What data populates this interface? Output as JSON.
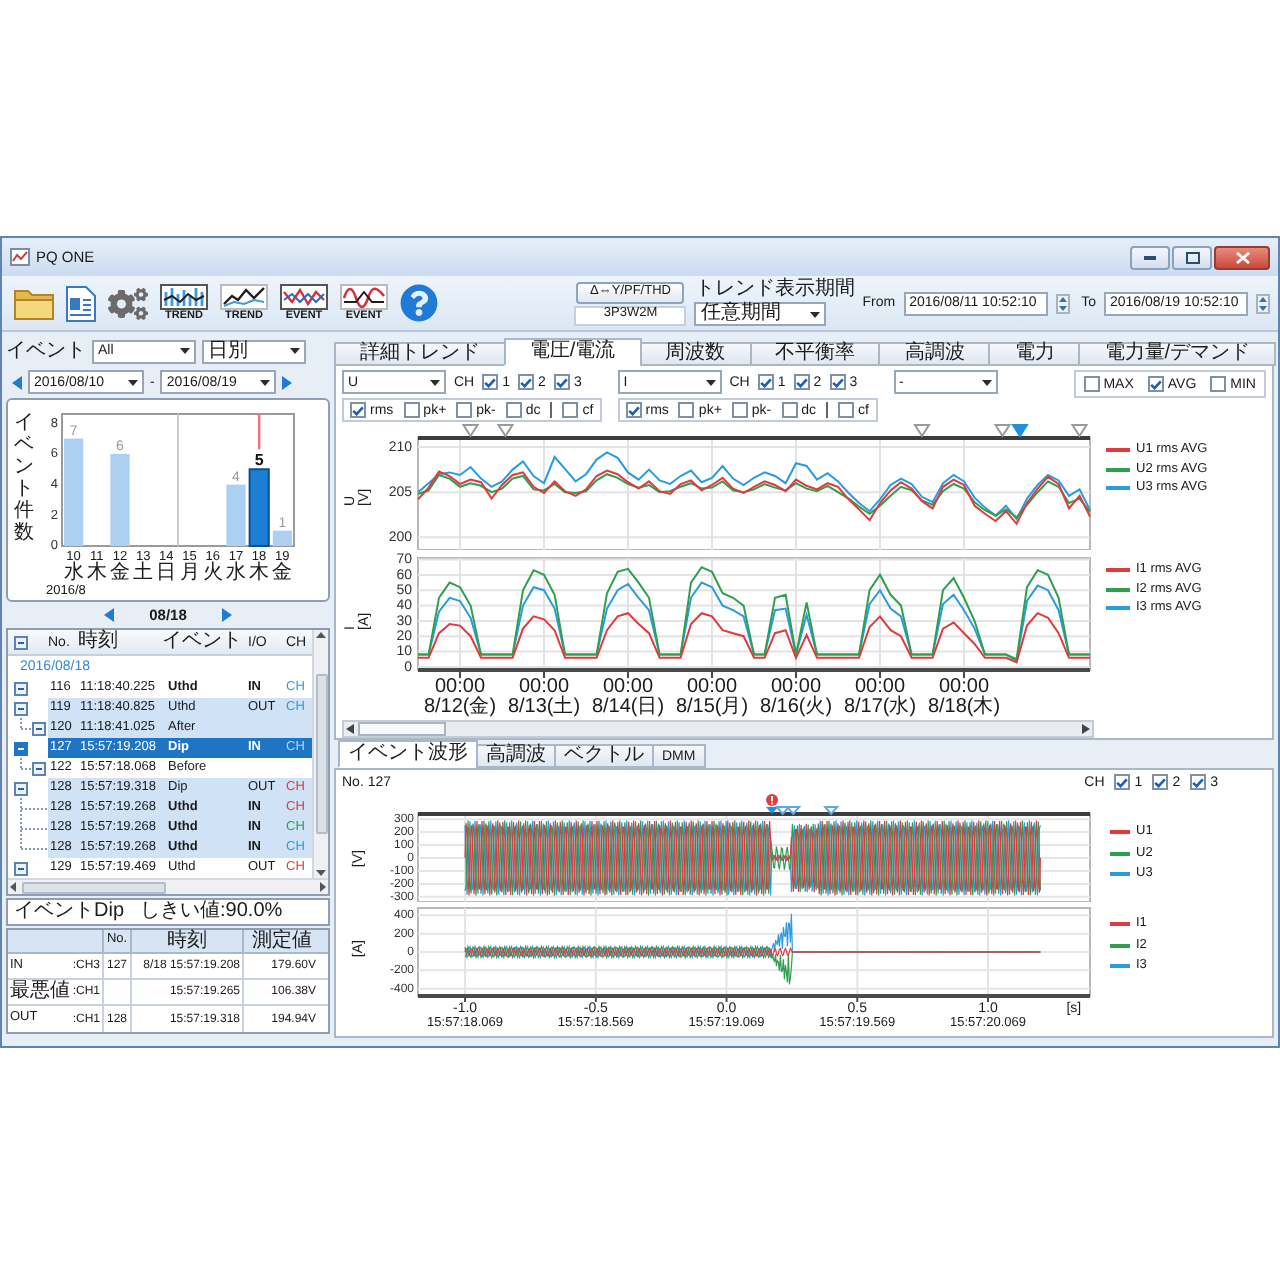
{
  "window": {
    "title": "PQ ONE"
  },
  "toolbar": {
    "buttons": [
      {
        "kind": "folder"
      },
      {
        "kind": "document"
      },
      {
        "kind": "settings"
      },
      {
        "kind": "trend_detail",
        "label": "TREND"
      },
      {
        "kind": "trend",
        "label": "TREND"
      },
      {
        "kind": "event_detail",
        "label": "EVENT"
      },
      {
        "kind": "event",
        "label": "EVENT"
      },
      {
        "kind": "help"
      }
    ],
    "wiring_button": "Δ⇔Y/PF/THD",
    "wiring": "3P3W2M",
    "period": {
      "label": "トレンド表示期間",
      "mode": "任意期間",
      "from_label": "From",
      "from": "2016/08/11 10:52:10",
      "to_label": "To",
      "to": "2016/08/19 10:52:10"
    }
  },
  "event_filter": {
    "label": "イベント",
    "type": "All",
    "interval": "日別",
    "from": "2016/08/10",
    "separator": "-",
    "to": "2016/08/19"
  },
  "event_chart": {
    "chart_data": {
      "type": "bar",
      "ylabel": "イベント件数",
      "xlabel": "2016/8",
      "categories": [
        "10",
        "11",
        "12",
        "13",
        "14",
        "15",
        "16",
        "17",
        "18",
        "19"
      ],
      "values": [
        7,
        0,
        6,
        0,
        0,
        0,
        0,
        4,
        5,
        1
      ],
      "ylim": [
        0,
        8.6
      ],
      "yticks": [
        0,
        2,
        4,
        6,
        8
      ],
      "value_labels": [
        "7",
        null,
        "6",
        null,
        null,
        null,
        null,
        "4",
        "5",
        "1"
      ]
    },
    "days": [
      {
        "weekday": "水",
        "selected": false
      },
      {
        "weekday": "木",
        "selected": false
      },
      {
        "weekday": "金",
        "selected": false
      },
      {
        "weekday": "土",
        "selected": false
      },
      {
        "weekday": "日",
        "selected": false
      },
      {
        "weekday": "月",
        "selected": false
      },
      {
        "weekday": "火",
        "selected": false
      },
      {
        "weekday": "水",
        "selected": false
      },
      {
        "weekday": "木",
        "selected": true
      },
      {
        "weekday": "金",
        "selected": false
      }
    ]
  },
  "day_nav": {
    "date": "08/18"
  },
  "event_list": {
    "columns": [
      "No.",
      "時刻",
      "イベント",
      "I/O",
      "CH"
    ],
    "groups": [
      {
        "date": "2016/08/18",
        "rows": [
          {
            "no": "116",
            "time": "11:18:40.225",
            "event": "Uthd",
            "io": "IN",
            "ch": "CH",
            "color": "#2b9be0",
            "bold": true,
            "highlighted": false,
            "selected": false
          },
          {
            "no": "119",
            "time": "11:18:40.825",
            "event": "Uthd",
            "io": "OUT",
            "ch": "CH",
            "color": "#2b9be0",
            "bold": false,
            "highlighted": true,
            "selected": false,
            "children": [
              {
                "kind": "waveform",
                "no": "120",
                "time": "11:18:41.025",
                "event": "After",
                "bold": false,
                "highlighted": true,
                "selected": false
              }
            ]
          },
          {
            "no": "127",
            "time": "15:57:19.208",
            "event": "Dip",
            "io": "IN",
            "ch": "CH",
            "color": "#a8dcff",
            "bold": true,
            "highlighted": false,
            "selected": true,
            "children": [
              {
                "kind": "waveform",
                "no": "122",
                "time": "15:57:18.068",
                "event": "Before",
                "bold": false,
                "highlighted": false,
                "selected": false
              }
            ]
          },
          {
            "no": "128",
            "time": "15:57:19.318",
            "event": "Dip",
            "io": "OUT",
            "ch": "CH",
            "color": "#e03a3e",
            "bold": false,
            "highlighted": true,
            "selected": false,
            "children": [
              {
                "kind": "channel",
                "no": "128",
                "time": "15:57:19.268",
                "event": "Uthd",
                "io": "IN",
                "ch": "CH",
                "color": "#e03a3e",
                "bold": true,
                "highlighted": true,
                "selected": false
              },
              {
                "kind": "channel",
                "no": "128",
                "time": "15:57:19.268",
                "event": "Uthd",
                "io": "IN",
                "ch": "CH",
                "color": "#2e9e4f",
                "bold": true,
                "highlighted": true,
                "selected": false
              },
              {
                "kind": "channel",
                "no": "128",
                "time": "15:57:19.268",
                "event": "Uthd",
                "io": "IN",
                "ch": "CH",
                "color": "#2b9be0",
                "bold": true,
                "highlighted": true,
                "selected": false
              }
            ]
          },
          {
            "no": "129",
            "time": "15:57:19.469",
            "event": "Uthd",
            "io": "OUT",
            "ch": "CH",
            "color": "#e03a3e",
            "bold": false,
            "highlighted": false,
            "selected": false
          }
        ]
      }
    ]
  },
  "event_summary": {
    "event": "イベントDip",
    "threshold": "しきい値:90.0%",
    "columns": [
      "No.",
      "時刻",
      "測定値"
    ],
    "rows": [
      {
        "label": "IN",
        "channel": ":CH3",
        "no": "127",
        "time": "8/18 15:57:19.208",
        "value": "179.60V"
      },
      {
        "label": "最悪値",
        "channel": ":CH1",
        "time": "15:57:19.265",
        "value": "106.38V"
      },
      {
        "label": "OUT",
        "channel": ":CH1",
        "no": "128",
        "time": "15:57:19.318",
        "value": "194.94V"
      }
    ]
  },
  "trend_tabs": [
    {
      "label": "詳細トレンド",
      "selected": false
    },
    {
      "label": "電圧/電流",
      "selected": true
    },
    {
      "label": "周波数",
      "selected": false
    },
    {
      "label": "不平衡率",
      "selected": false
    },
    {
      "label": "高調波",
      "selected": false
    },
    {
      "label": "電力",
      "selected": false
    },
    {
      "label": "電力量/デマンド",
      "selected": false
    }
  ],
  "selectors": [
    {
      "quantity": "U",
      "ch_label": "CH",
      "channels": [
        {
          "label": "1",
          "checked": true
        },
        {
          "label": "2",
          "checked": true
        },
        {
          "label": "3",
          "checked": true
        }
      ],
      "values": [
        {
          "label": "rms",
          "checked": true
        },
        {
          "label": "pk+",
          "checked": false
        },
        {
          "label": "pk-",
          "checked": false
        },
        {
          "label": "dc",
          "checked": false
        },
        {
          "label": "cf",
          "checked": false
        }
      ]
    },
    {
      "quantity": "I",
      "ch_label": "CH",
      "channels": [
        {
          "label": "1",
          "checked": true
        },
        {
          "label": "2",
          "checked": true
        },
        {
          "label": "3",
          "checked": true
        }
      ],
      "values": [
        {
          "label": "rms",
          "checked": true
        },
        {
          "label": "pk+",
          "checked": false
        },
        {
          "label": "pk-",
          "checked": false
        },
        {
          "label": "dc",
          "checked": false
        },
        {
          "label": "cf",
          "checked": false
        }
      ]
    },
    {
      "quantity": "-"
    }
  ],
  "statistics": [
    {
      "label": "MAX",
      "checked": false
    },
    {
      "label": "AVG",
      "checked": true
    },
    {
      "label": "MIN",
      "checked": false
    }
  ],
  "trend_charts": [
    {
      "event_markers": [
        {
          "selected": false
        },
        {
          "selected": false
        },
        {
          "selected": false
        },
        {
          "selected": false
        },
        {
          "selected": true
        },
        {
          "selected": false
        }
      ],
      "chart_data": {
        "type": "line",
        "ylabel": "U [V]",
        "grid": true,
        "legend": "right",
        "categories": [
          null,
          null,
          null,
          null,
          null,
          null,
          null,
          null,
          null,
          null,
          null,
          null,
          null,
          null,
          null,
          null,
          null,
          null,
          null,
          null,
          null,
          null,
          null,
          null,
          null,
          null,
          null,
          null,
          null,
          null,
          null,
          null,
          null,
          null,
          null,
          null,
          null,
          null,
          null,
          null,
          null,
          null,
          null,
          null,
          null,
          null,
          null,
          null,
          null,
          null,
          null,
          null,
          null,
          null,
          null,
          null,
          null,
          null,
          null,
          null,
          null,
          null,
          null,
          null,
          null
        ],
        "ylim": [
          198.6,
          211
        ],
        "yticks": [
          200,
          205,
          210
        ],
        "series": [
          {
            "name": "U1 rms AVG",
            "color": "#e03a3e",
            "values": [
              204.2,
              205.5,
              207.3,
              206.8,
              205.9,
              206.4,
              206.1,
              204.3,
              205.8,
              206.9,
              207.2,
              205.6,
              204.9,
              206.2,
              205.1,
              204.6,
              205.3,
              206.8,
              207.4,
              207.0,
              206.1,
              205.4,
              206.2,
              205.1,
              204.8,
              205.9,
              206.3,
              205.2,
              205.8,
              206.6,
              205.4,
              204.9,
              205.6,
              206.2,
              205.8,
              205.1,
              206.4,
              205.7,
              205.3,
              206.0,
              205.6,
              204.2,
              203.1,
              201.9,
              203.8,
              205.2,
              206.1,
              205.4,
              204.0,
              203.2,
              205.6,
              206.4,
              205.8,
              203.5,
              202.6,
              201.8,
              202.9,
              201.5,
              203.8,
              205.4,
              206.7,
              205.9,
              203.2,
              204.6,
              202.3
            ]
          },
          {
            "name": "U2 rms AVG",
            "color": "#2e9e4f",
            "values": [
              204.8,
              205.2,
              206.9,
              206.5,
              205.6,
              206.0,
              205.7,
              205.0,
              205.4,
              206.5,
              206.8,
              205.3,
              205.2,
              205.9,
              205.0,
              204.9,
              205.1,
              206.3,
              207.0,
              206.6,
              205.9,
              205.5,
              205.8,
              205.0,
              205.1,
              205.6,
              206.0,
              205.4,
              205.5,
              206.2,
              205.2,
              205.0,
              205.3,
              205.9,
              205.5,
              205.2,
              206.0,
              205.4,
              205.1,
              205.7,
              205.0,
              204.3,
              203.4,
              202.6,
              203.5,
              204.6,
              205.6,
              205.2,
              204.1,
              203.6,
              205.1,
              205.9,
              205.4,
              203.9,
              203.0,
              202.4,
              203.1,
              202.2,
              203.6,
              205.0,
              206.2,
              205.6,
              203.8,
              204.3,
              202.8
            ]
          },
          {
            "name": "U3 rms AVG",
            "color": "#2b9be0",
            "values": [
              205.0,
              206.0,
              207.0,
              207.2,
              206.9,
              207.8,
              206.5,
              205.6,
              206.2,
              207.5,
              208.4,
              206.8,
              206.0,
              208.9,
              207.6,
              206.2,
              207.0,
              208.6,
              209.4,
              208.8,
              207.2,
              206.4,
              207.5,
              206.3,
              205.9,
              206.8,
              207.4,
              206.1,
              206.6,
              207.9,
              206.5,
              205.8,
              206.6,
              207.2,
              206.8,
              206.0,
              208.2,
              207.9,
              206.4,
              207.1,
              206.2,
              204.9,
              203.8,
              202.9,
              204.2,
              205.8,
              206.5,
              205.9,
              204.5,
              203.9,
              206.0,
              206.9,
              206.2,
              204.4,
              203.3,
              202.4,
              203.5,
              202.0,
              204.3,
              205.8,
              206.9,
              206.3,
              204.6,
              205.3,
              203.0
            ]
          }
        ]
      }
    },
    {
      "chart_data": {
        "type": "line",
        "ylabel": "I [A]",
        "grid": true,
        "legend": "right",
        "categories": [
          null,
          null,
          null,
          null,
          "00:00 8/12(金)",
          null,
          null,
          null,
          null,
          null,
          null,
          null,
          "00:00 8/13(土)",
          null,
          null,
          null,
          null,
          null,
          null,
          null,
          "00:00 8/14(日)",
          null,
          null,
          null,
          null,
          null,
          null,
          null,
          "00:00 8/15(月)",
          null,
          null,
          null,
          null,
          null,
          null,
          null,
          "00:00 8/16(火)",
          null,
          null,
          null,
          null,
          null,
          null,
          null,
          "00:00 8/17(水)",
          null,
          null,
          null,
          null,
          null,
          null,
          null,
          "00:00 8/18(木)",
          null,
          null,
          null,
          null,
          null,
          null,
          null,
          null,
          null,
          null,
          null,
          null
        ],
        "ylim": [
          -2,
          71
        ],
        "yticks": [
          0,
          10,
          20,
          30,
          40,
          50,
          60,
          70
        ],
        "series": [
          {
            "name": "I1 rms AVG",
            "color": "#e03a3e",
            "values": [
              6,
              6,
              22,
              28,
              27,
              20,
              6,
              6,
              6,
              6,
              25,
              33,
              31,
              24,
              6,
              6,
              6,
              6,
              24,
              33,
              35,
              28,
              22,
              6,
              6,
              6,
              28,
              35,
              33,
              24,
              22,
              20,
              6,
              6,
              22,
              24,
              6,
              21,
              6,
              6,
              6,
              6,
              6,
              26,
              33,
              24,
              20,
              6,
              6,
              6,
              25,
              29,
              22,
              15,
              6,
              6,
              6,
              3,
              27,
              35,
              32,
              22,
              6,
              6,
              6
            ]
          },
          {
            "name": "I2 rms AVG",
            "color": "#2e9e4f",
            "values": [
              8,
              8,
              45,
              55,
              52,
              40,
              8,
              8,
              8,
              8,
              50,
              63,
              60,
              47,
              8,
              8,
              8,
              8,
              48,
              62,
              64,
              55,
              45,
              8,
              8,
              8,
              55,
              65,
              62,
              48,
              45,
              40,
              8,
              8,
              45,
              47,
              8,
              42,
              8,
              8,
              8,
              8,
              8,
              50,
              60,
              47,
              40,
              8,
              8,
              8,
              50,
              58,
              45,
              30,
              8,
              8,
              8,
              5,
              52,
              63,
              60,
              45,
              8,
              8,
              8
            ]
          },
          {
            "name": "I3 rms AVG",
            "color": "#2b9be0",
            "values": [
              8,
              8,
              36,
              45,
              43,
              32,
              8,
              8,
              8,
              8,
              40,
              52,
              50,
              38,
              8,
              8,
              8,
              8,
              38,
              50,
              54,
              45,
              37,
              8,
              8,
              8,
              45,
              55,
              52,
              40,
              37,
              33,
              8,
              8,
              37,
              38,
              8,
              34,
              8,
              8,
              8,
              8,
              8,
              41,
              50,
              38,
              33,
              8,
              8,
              8,
              41,
              47,
              37,
              25,
              8,
              8,
              8,
              4,
              43,
              53,
              50,
              37,
              8,
              8,
              8
            ]
          }
        ]
      }
    }
  ],
  "detail_tabs": [
    {
      "label": "イベント波形",
      "selected": true
    },
    {
      "label": "高調波",
      "selected": false
    },
    {
      "label": "ベクトル",
      "selected": false
    },
    {
      "label": "DMM",
      "selected": false
    }
  ],
  "waveform": {
    "event_no": "No. 127",
    "ch_label": "CH",
    "channels": [
      {
        "label": "1",
        "checked": true
      },
      {
        "label": "2",
        "checked": true
      },
      {
        "label": "3",
        "checked": true
      }
    ],
    "plots": [
      {
        "unit": "[V]",
        "yticks": [
          "300",
          "200",
          "100",
          "0",
          "-100",
          "-200",
          "-300"
        ],
        "legend": [
          {
            "label": "U1",
            "color": "#e03a3e"
          },
          {
            "label": "U2",
            "color": "#2e9e4f"
          },
          {
            "label": "U3",
            "color": "#2b9be0"
          }
        ]
      },
      {
        "unit": "[A]",
        "yticks": [
          "400",
          "200",
          "0",
          "-200",
          "-400"
        ],
        "legend": [
          {
            "label": "I1",
            "color": "#e03a3e"
          },
          {
            "label": "I2",
            "color": "#2e9e4f"
          },
          {
            "label": "I3",
            "color": "#2b9be0"
          }
        ]
      }
    ],
    "xticks": [
      {
        "value": "-1.0",
        "time": "15:57:18.069"
      },
      {
        "value": "-0.5",
        "time": "15:57:18.569"
      },
      {
        "value": "0.0",
        "time": "15:57:19.069"
      },
      {
        "value": "0.5",
        "time": "15:57:19.569"
      },
      {
        "value": "1.0",
        "time": "15:57:20.069"
      }
    ],
    "xunit": "[s]"
  }
}
